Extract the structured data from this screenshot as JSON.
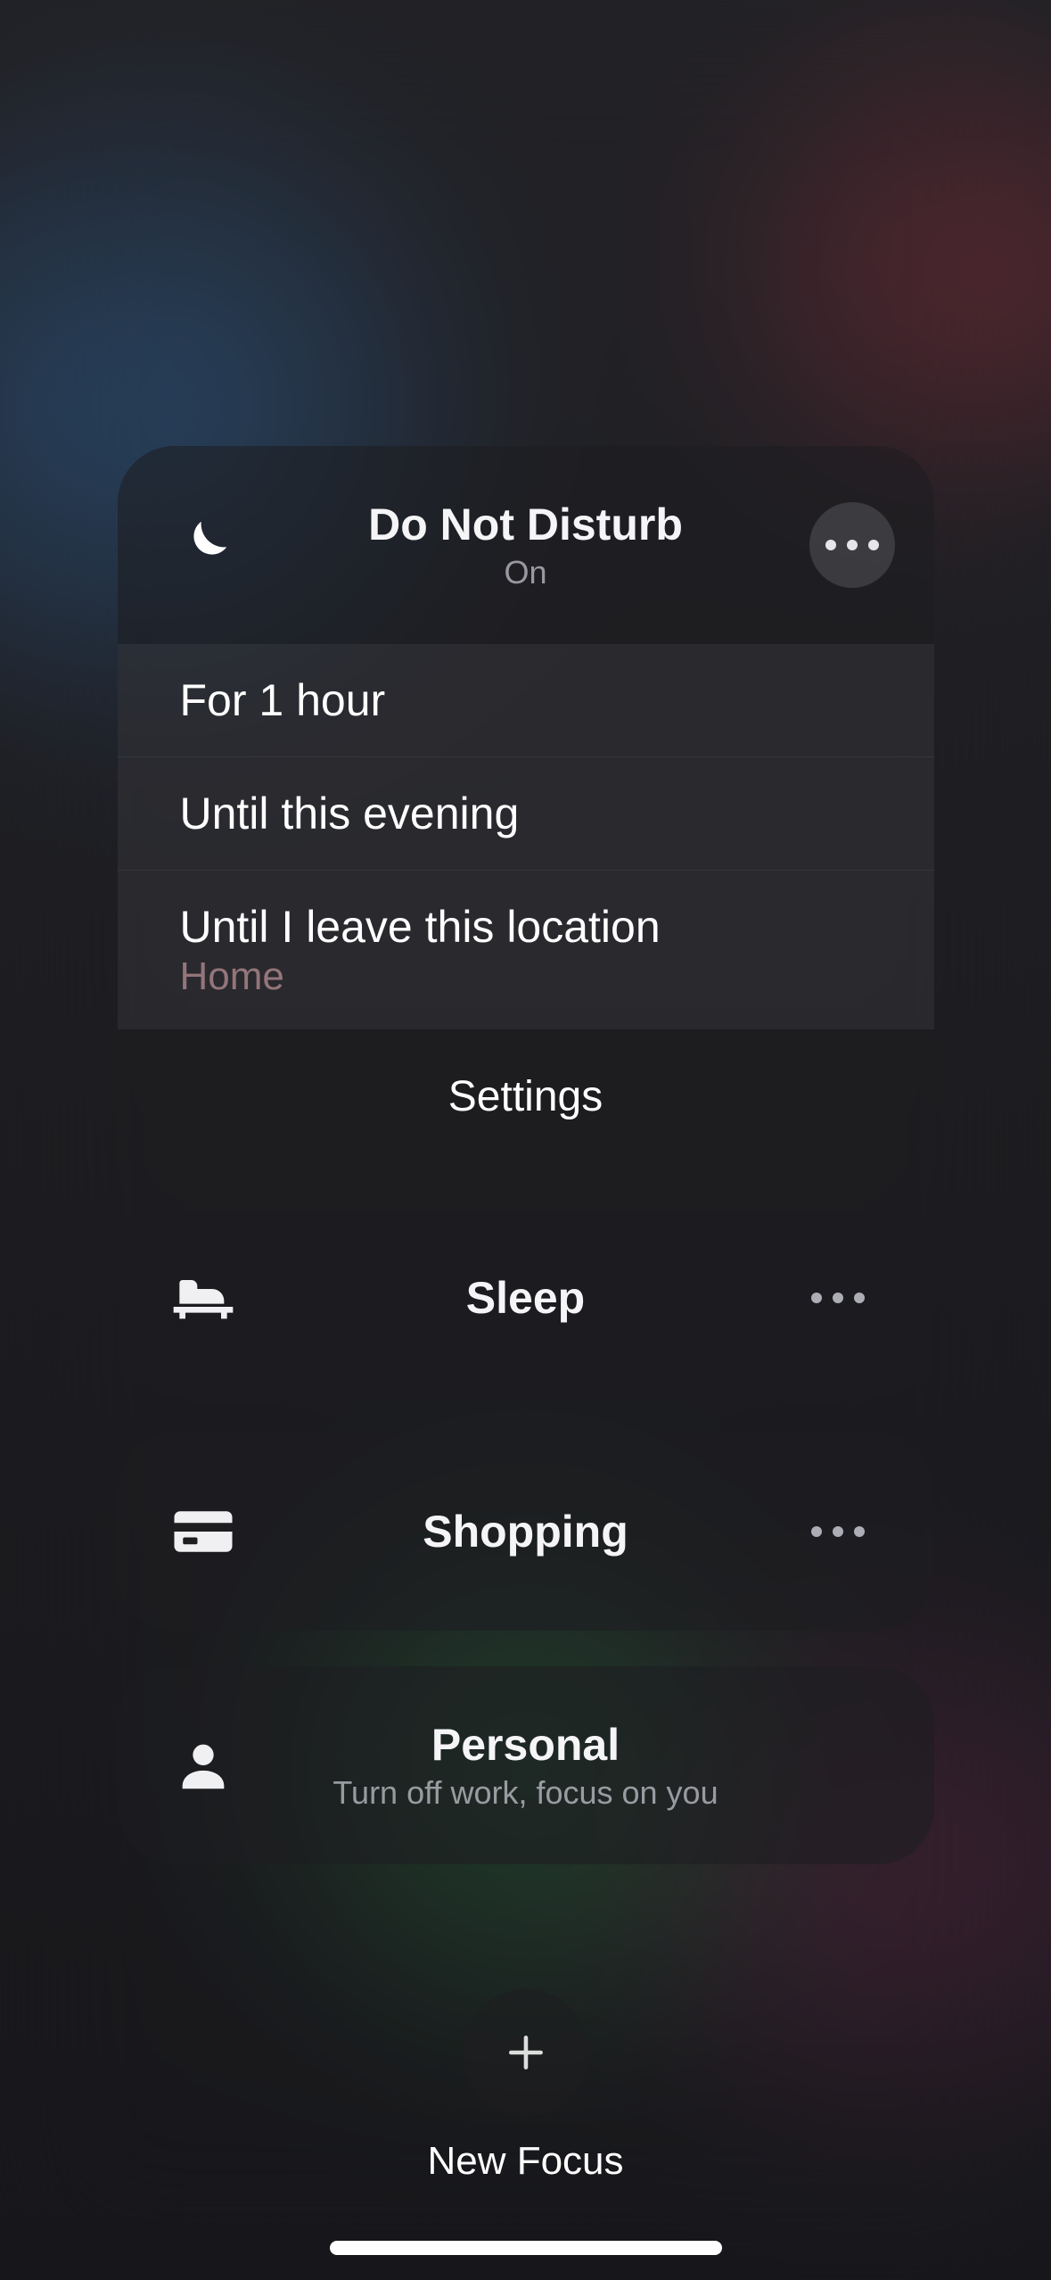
{
  "focus": {
    "dnd": {
      "title": "Do Not Disturb",
      "status": "On",
      "options": [
        {
          "label": "For 1 hour"
        },
        {
          "label": "Until this evening"
        },
        {
          "label": "Until I leave this location",
          "sub": "Home"
        }
      ],
      "settings_label": "Settings"
    },
    "modes": [
      {
        "id": "sleep",
        "label": "Sleep",
        "icon": "bed-icon"
      },
      {
        "id": "shopping",
        "label": "Shopping",
        "icon": "card-icon"
      },
      {
        "id": "personal",
        "label": "Personal",
        "sub": "Turn off work, focus on you",
        "icon": "person-icon"
      }
    ]
  },
  "new_focus_label": "New Focus"
}
